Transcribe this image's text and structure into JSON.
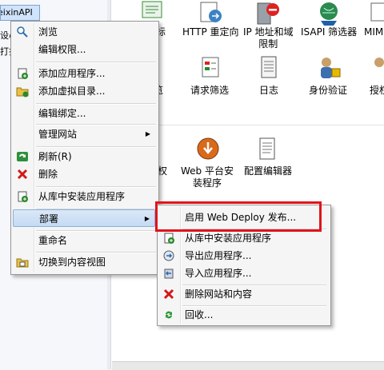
{
  "tree": {
    "selected_node": "eixinAPI",
    "stub1": "设心",
    "stub2": "打抠"
  },
  "features": {
    "row1": [
      "应标",
      "HTTP 重定向",
      "IP 地址和域\n限制",
      "ISAPI 筛选器",
      "MIM"
    ],
    "row2": [
      "览",
      "请求筛选",
      "日志",
      "身份验证",
      "授权"
    ],
    "row3": [
      "握权",
      "Web 平台安\n装程序",
      "配置编辑器"
    ]
  },
  "context_menu": {
    "items": [
      {
        "label": "浏览",
        "icon": "browse-icon"
      },
      {
        "label": "编辑权限...",
        "icon": ""
      },
      {
        "label": "添加应用程序...",
        "icon": "add-app-icon"
      },
      {
        "label": "添加虚拟目录...",
        "icon": "add-vdir-icon"
      },
      {
        "label": "编辑绑定...",
        "icon": ""
      },
      {
        "label": "管理网站",
        "icon": "",
        "submenu": true
      },
      {
        "label": "刷新(R)",
        "icon": "refresh-icon"
      },
      {
        "label": "删除",
        "icon": "delete-icon"
      },
      {
        "label": "从库中安装应用程序",
        "icon": "gallery-icon"
      },
      {
        "label": "部署",
        "icon": "",
        "submenu": true,
        "selected": true
      },
      {
        "label": "重命名",
        "icon": ""
      },
      {
        "label": "切换到内容视图",
        "icon": "content-view-icon"
      }
    ]
  },
  "deploy_submenu": {
    "items": [
      {
        "label": "启用 Web Deploy 发布...",
        "icon": ""
      },
      {
        "label": "从库中安装应用程序",
        "icon": "gallery-icon"
      },
      {
        "label": "导出应用程序...",
        "icon": "export-icon"
      },
      {
        "label": "导入应用程序...",
        "icon": "import-icon"
      },
      {
        "label": "删除网站和内容",
        "icon": "delete-icon"
      },
      {
        "label": "回收...",
        "icon": "recycle-icon"
      }
    ]
  },
  "colors": {
    "highlight_border": "#e0141a",
    "menu_selection": "#c4daf4"
  }
}
